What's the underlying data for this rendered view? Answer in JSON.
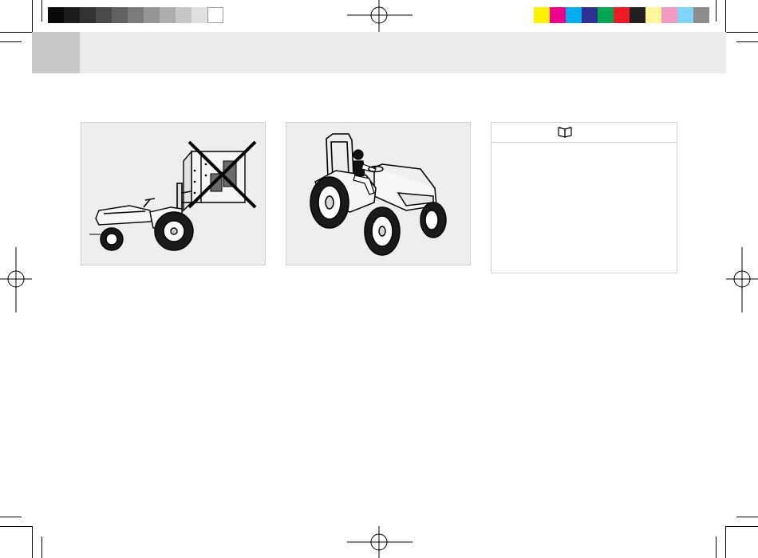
{
  "color_bars": {
    "gray_steps": [
      "#0a0a0a",
      "#1c1c1c",
      "#333333",
      "#4a4a4a",
      "#626262",
      "#7b7b7b",
      "#959595",
      "#adadad",
      "#c6c6c6",
      "#e0e0e0",
      "#ffffff"
    ],
    "process_colors": [
      "#fff200",
      "#ec008c",
      "#00aeef",
      "#2e3192",
      "#00a651",
      "#ed1c24",
      "#231f20",
      "#fff799",
      "#f49ac1",
      "#7fd5f7",
      "#8c8c8c"
    ]
  },
  "colors": {
    "header_band": "#ececec",
    "header_tab": "#c9c9c9",
    "figure_background": "#eeeeee",
    "panel_border": "#cfcfcf"
  },
  "figures": [
    {
      "depicts": "tractor-with-rear-implement-crossed-out",
      "icon": "prohibited-cross"
    },
    {
      "depicts": "tractor-with-operator-and-rops",
      "icon": "tractor"
    }
  ],
  "note_panel": {
    "icon": "open-book-icon"
  }
}
